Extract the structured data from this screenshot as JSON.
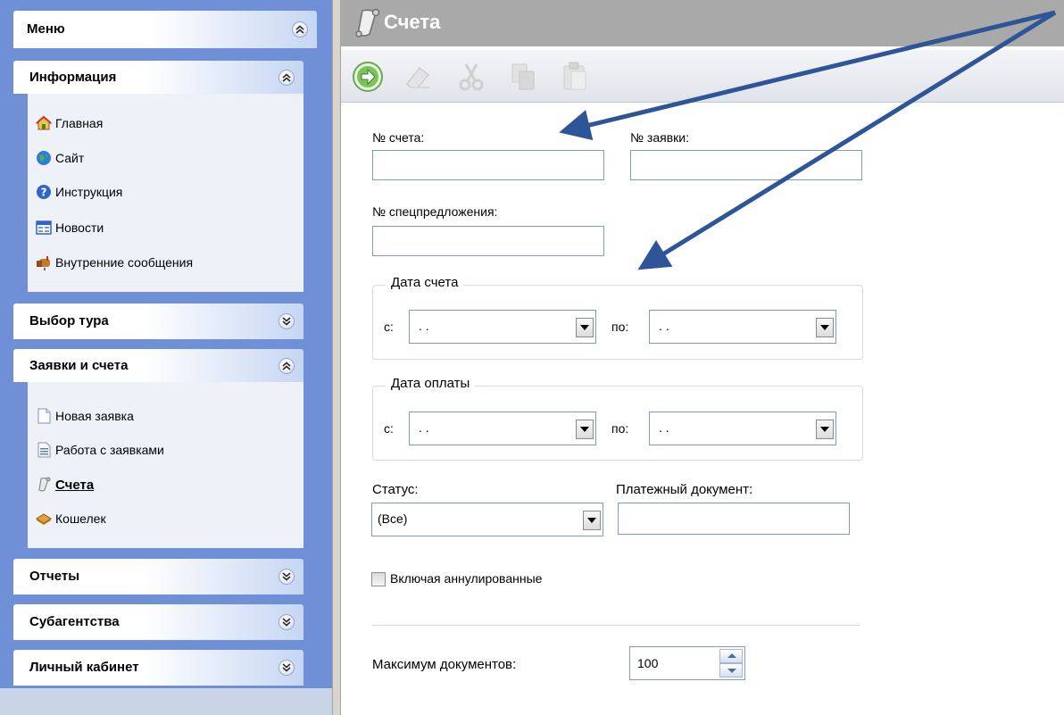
{
  "sidebar": {
    "menu_title": "Меню",
    "sections": [
      {
        "title": "Информация",
        "state": "expanded",
        "items": [
          "Главная",
          "Сайт",
          "Инструкция",
          "Новости",
          "Внутренние сообщения"
        ]
      },
      {
        "title": "Выбор тура",
        "state": "collapsed"
      },
      {
        "title": "Заявки и счета",
        "state": "expanded",
        "items": [
          "Новая заявка",
          "Работа с заявками",
          "Счета",
          "Кошелек"
        ],
        "active_item": "Счета"
      },
      {
        "title": "Отчеты",
        "state": "collapsed"
      },
      {
        "title": "Субагентства",
        "state": "collapsed"
      },
      {
        "title": "Личный кабинет",
        "state": "collapsed"
      }
    ]
  },
  "page": {
    "title": "Счета"
  },
  "toolbar": {
    "buttons": [
      "go-icon",
      "eraser-icon",
      "cut-icon",
      "copy-icon",
      "paste-icon"
    ]
  },
  "form": {
    "invoice_no": {
      "label": "№ счета:",
      "value": ""
    },
    "request_no": {
      "label": "№ заявки:",
      "value": ""
    },
    "special_offer_no": {
      "label": "№ спецпредложения:",
      "value": ""
    },
    "invoice_date": {
      "title": "Дата счета",
      "from_label": "с:",
      "from_value": ". .",
      "to_label": "по:",
      "to_value": ". ."
    },
    "payment_date": {
      "title": "Дата оплаты",
      "from_label": "с:",
      "from_value": ". .",
      "to_label": "по:",
      "to_value": ". ."
    },
    "status": {
      "label": "Статус:",
      "value": "(Все)"
    },
    "payment_doc": {
      "label": "Платежный документ:",
      "value": ""
    },
    "include_cancelled": {
      "label": "Включая аннулированные",
      "checked": false
    },
    "max_docs": {
      "label": "Максимум документов:",
      "value": "100"
    }
  },
  "colors": {
    "sidebar_bg": "#6f90d6",
    "titlebar_bg": "#a9a9a9",
    "arrow": "#2e5597"
  }
}
